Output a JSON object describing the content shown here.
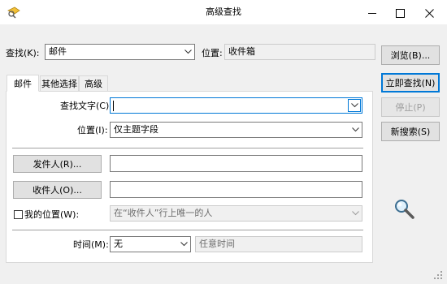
{
  "window": {
    "title": "高级查找"
  },
  "search_in": {
    "label": "查找(K):",
    "value": "邮件",
    "location_label": "位置:",
    "location_value": "收件箱"
  },
  "buttons": {
    "browse": "浏览(B)...",
    "find_now": "立即查找(N)",
    "stop": "停止(P)",
    "new_search": "新搜索(S)"
  },
  "tabs": [
    "邮件",
    "其他选择",
    "高级"
  ],
  "mail": {
    "search_text_label": "查找文字(C):",
    "search_text_value": "",
    "in_label": "位置(I):",
    "in_value": "仅主题字段",
    "from_button": "发件人(R)...",
    "from_value": "",
    "sent_to_button": "收件人(O)...",
    "sent_to_value": "",
    "where_label": "我的位置(W):",
    "where_value": "在“收件人”行上唯一的人",
    "time_label": "时间(M):",
    "time_value": "无",
    "time_range_value": "任意时间"
  }
}
